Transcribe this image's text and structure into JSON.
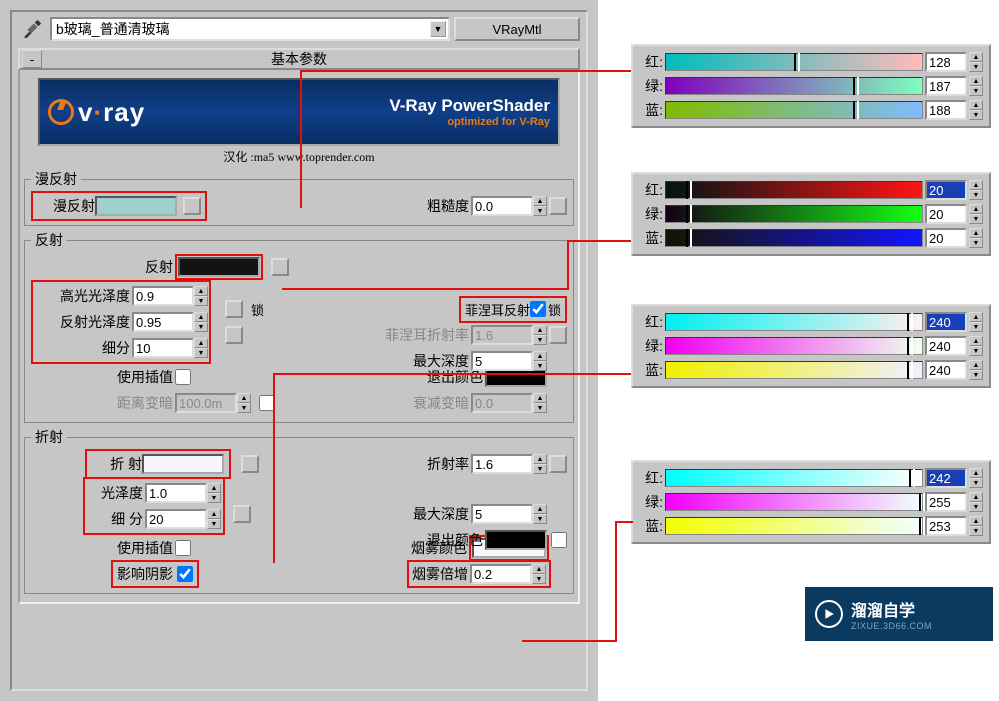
{
  "toolbar": {
    "material_name": "b玻璃_普通清玻璃",
    "material_type": "VRayMtl"
  },
  "section_basic": {
    "title": "基本参数"
  },
  "banner": {
    "logo_text": "v·ray",
    "title": "V-Ray PowerShader",
    "subtitle": "optimized for V-Ray",
    "credit": "汉化 :ma5 www.toprender.com"
  },
  "diffuse": {
    "group": "漫反射",
    "label": "漫反射",
    "swatch_color": "#9fd0d0",
    "roughness_label": "粗糙度",
    "roughness": "0.0"
  },
  "reflect": {
    "group": "反射",
    "label": "反射",
    "swatch_color": "#131313",
    "highlight_gloss_label": "高光光泽度",
    "highlight_gloss": "0.9",
    "lock_label": "锁",
    "fresnel_label": "菲涅耳反射",
    "fresnel_checked": true,
    "fresnel_lock": "锁",
    "reflect_gloss_label": "反射光泽度",
    "reflect_gloss": "0.95",
    "fresnel_ior_label": "菲涅耳折射率",
    "fresnel_ior": "1.6",
    "subdiv_label": "细分",
    "subdiv": "10",
    "maxdepth_label": "最大深度",
    "maxdepth": "5",
    "useinterp_label": "使用插值",
    "exitcolor_label": "退出颜色",
    "exit_swatch": "#000000",
    "dimdist_label": "距离变暗",
    "dimdist": "100.0m",
    "dimfalloff_label": "衰减变暗",
    "dimfalloff": "0.0"
  },
  "refract": {
    "group": "折射",
    "label": "折 射",
    "swatch_color": "#f2f2fc",
    "ior_label": "折射率",
    "ior": "1.6",
    "gloss_label": "光泽度",
    "gloss": "1.0",
    "maxdepth_label": "最大深度",
    "maxdepth": "5",
    "subdiv_label": "细 分",
    "subdiv": "20",
    "exitcolor_label": "退出颜色",
    "exit_swatch": "#000000",
    "useinterp_label": "使用插值",
    "fogcolor_label": "烟雾颜色",
    "fog_swatch": "#f6f8fc",
    "affectshadows_label": "影响阴影",
    "affectshadows_checked": true,
    "fogmult_label": "烟雾倍增",
    "fogmult": "0.2"
  },
  "rgb_panels": {
    "labels": {
      "r": "红:",
      "g": "绿:",
      "b": "蓝:"
    },
    "panel1": {
      "r": "128",
      "g": "187",
      "b": "188",
      "r_grad": "linear-gradient(to right,#00bcbc,#ffbcbc)",
      "g_grad": "linear-gradient(to right,#8000bc,#80ffbc)",
      "b_grad": "linear-gradient(to right,#80bb00,#80bbff)",
      "r_pos": "50%",
      "g_pos": "73%",
      "b_pos": "73%"
    },
    "panel2": {
      "r": "20",
      "g": "20",
      "b": "20",
      "r_grad": "linear-gradient(to right,#001414,#ff1414)",
      "g_grad": "linear-gradient(to right,#140014,#14ff14)",
      "b_grad": "linear-gradient(to right,#141400,#1414ff)",
      "r_pos": "8%",
      "g_pos": "8%",
      "b_pos": "8%",
      "r_selected": true
    },
    "panel3": {
      "r": "240",
      "g": "240",
      "b": "240",
      "r_grad": "linear-gradient(to right,#00f0f0,#fff0f0)",
      "g_grad": "linear-gradient(to right,#f000f0,#f0fff0)",
      "b_grad": "linear-gradient(to right,#f0f000,#f0f0ff)",
      "r_pos": "94%",
      "g_pos": "94%",
      "b_pos": "94%",
      "r_selected": true
    },
    "panel4": {
      "r": "242",
      "g": "255",
      "b": "253",
      "r_grad": "linear-gradient(to right,#00fffd,#fffffd)",
      "g_grad": "linear-gradient(to right,#f200fd,#f2fffd)",
      "b_grad": "linear-gradient(to right,#f2ff00,#f2ffff)",
      "r_pos": "95%",
      "g_pos": "99%",
      "b_pos": "99%",
      "r_selected": true
    }
  },
  "watermark": {
    "title": "溜溜自学",
    "url": "ZIXUE.3D66.COM"
  }
}
